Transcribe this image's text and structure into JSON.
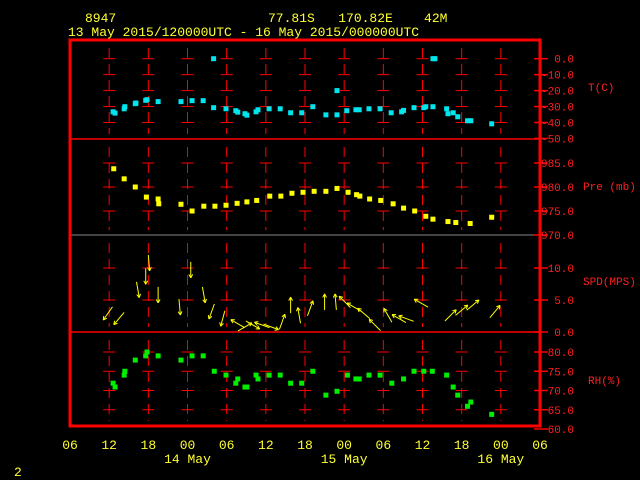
{
  "header": {
    "station_id": "8947",
    "location": "77.81S   170.82E    42M",
    "time_range": "13 May 2015/120000UTC - 16 May 2015/000000UTC"
  },
  "page_number": "2",
  "colors": {
    "frame": "#ff0000",
    "text": "#ffff33",
    "temp": "#00e5ee",
    "pressure": "#ffff00",
    "wind": "#ffff00",
    "rh": "#00ee00",
    "axis": "#ff2020"
  },
  "chart_data": [
    {
      "type": "scatter",
      "title": "T(C)",
      "ylabel": "T(C)",
      "x_units": "hours since 13 May 2015 06UTC",
      "xlim": [
        0,
        72
      ],
      "ylim": [
        -50,
        0
      ],
      "y_ticks": [
        "0.0",
        "-10.0",
        "-20.0",
        "-30.0",
        "-40.0",
        "-50.0"
      ],
      "x": [
        6.6,
        6.9,
        8.3,
        8.4,
        10,
        10.1,
        11.6,
        11.8,
        13.5,
        17,
        18.7,
        20.4,
        22,
        23.9,
        25.4,
        25.7,
        26.8,
        27.1,
        28.5,
        28.8,
        30.5,
        32.2,
        33.8,
        35.5,
        37.2,
        39.2,
        40.9,
        42.4,
        43.8,
        44.3,
        45.8,
        47.5,
        49.2,
        50.8,
        51.1,
        52.7,
        54.2,
        54.5,
        55.6,
        57.7,
        57.9,
        58.7,
        59.4,
        60.9,
        61.4,
        64.6,
        22,
        40.9,
        55.6,
        55.9
      ],
      "y": [
        -33.3,
        -34.1,
        -31.4,
        -30.1,
        -28.2,
        -27.8,
        -26.1,
        -25.7,
        -26.9,
        -26.9,
        -26.3,
        -26.3,
        -30.7,
        -31.4,
        -32.6,
        -33.5,
        -34.5,
        -35.4,
        -33.3,
        -32,
        -31.4,
        -31.4,
        -33.9,
        -33.9,
        -30.1,
        -35.2,
        -35.2,
        -32.6,
        -32,
        -32,
        -31.4,
        -31.4,
        -33.9,
        -33.3,
        -32.4,
        -30.7,
        -30.7,
        -30.1,
        -30.1,
        -31.4,
        -34.5,
        -33.9,
        -36.4,
        -38.9,
        -38.9,
        -40.8,
        0,
        -20,
        0,
        0
      ]
    },
    {
      "type": "scatter",
      "title": "Pre (mb)",
      "ylabel": "Pre (mb)",
      "xlim": [
        0,
        72
      ],
      "ylim": [
        970,
        988
      ],
      "y_ticks": [
        "985.0",
        "980.0",
        "975.0",
        "970.0"
      ],
      "x": [
        6.7,
        8.3,
        10,
        11.7,
        13.5,
        13.6,
        17,
        18.7,
        20.5,
        22.2,
        23.9,
        25.6,
        27.1,
        28.6,
        30.6,
        32.3,
        34,
        35.7,
        37.4,
        39.2,
        40.9,
        42.6,
        43.9,
        44.4,
        45.9,
        47.6,
        49.5,
        51.1,
        52.8,
        54.5,
        55.6,
        57.9,
        59.1,
        61.3,
        64.6
      ],
      "y": [
        983.8,
        981.7,
        980,
        977.9,
        977.5,
        976.5,
        976.4,
        975,
        976,
        976,
        976.2,
        976.6,
        976.9,
        977.2,
        978.1,
        978.1,
        978.7,
        978.9,
        979.1,
        979.1,
        979.7,
        978.9,
        978.4,
        978.1,
        977.5,
        977.2,
        976.5,
        975.6,
        975,
        973.9,
        973.3,
        972.8,
        972.6,
        972.4,
        973.7
      ]
    },
    {
      "type": "vector",
      "title": "SPD(MPS)",
      "ylabel": "SPD(MPS)",
      "xlim": [
        0,
        72
      ],
      "ylim": [
        0,
        12
      ],
      "y_ticks": [
        "10.0",
        "5.0",
        "0.0"
      ],
      "x": [
        5.8,
        7.5,
        10.4,
        11.6,
        12.1,
        13.5,
        16.8,
        18.5,
        20.5,
        21.7,
        23.4,
        25.7,
        26.8,
        28,
        29.4,
        30.8,
        32.5,
        33.8,
        35.1,
        36.8,
        39,
        40.7,
        42.1,
        43.5,
        45,
        46.7,
        48.7,
        50.4,
        51.5,
        53.8,
        58.3,
        60,
        61.7,
        65.1
      ],
      "speed": [
        2.9,
        2.1,
        6.6,
        8.7,
        10.8,
        5.8,
        3.9,
        9.7,
        5.8,
        3.2,
        2.1,
        1.3,
        0.8,
        1.1,
        1.1,
        0.8,
        1.6,
        4.2,
        2.6,
        3.7,
        4.7,
        4.7,
        4.7,
        3.9,
        2.9,
        1.1,
        2.6,
        2.1,
        2.1,
        4.5,
        2.6,
        3.4,
        4.2,
        3.2
      ],
      "direction_deg": [
        215,
        220,
        170,
        180,
        175,
        180,
        175,
        180,
        170,
        200,
        195,
        300,
        60,
        120,
        290,
        110,
        20,
        0,
        350,
        20,
        0,
        355,
        315,
        300,
        310,
        315,
        330,
        300,
        290,
        300,
        45,
        50,
        50,
        40
      ]
    },
    {
      "type": "scatter",
      "title": "RH(%)",
      "ylabel": "RH(%)",
      "xlim": [
        0,
        72
      ],
      "ylim": [
        60,
        83
      ],
      "y_ticks": [
        "80.0",
        "75.0",
        "70.0",
        "65.0",
        "60.0"
      ],
      "x": [
        6.6,
        6.9,
        8.3,
        8.4,
        10,
        11.6,
        11.8,
        13.5,
        17,
        18.7,
        20.4,
        22.1,
        23.9,
        25.4,
        25.7,
        26.8,
        27.1,
        28.5,
        28.8,
        30.5,
        32.2,
        33.8,
        35.5,
        37.2,
        39.2,
        40.9,
        42.5,
        43.8,
        44.3,
        45.8,
        47.5,
        49.3,
        51.1,
        52.7,
        54.2,
        55.5,
        57.7,
        58.7,
        59.4,
        60.9,
        61.4,
        64.6
      ],
      "y": [
        71.9,
        70.9,
        74,
        75,
        77.9,
        79,
        80,
        79,
        77.9,
        79,
        79,
        75,
        74,
        71.9,
        73,
        70.9,
        70.9,
        74,
        73,
        74,
        74,
        71.9,
        71.9,
        75,
        68.8,
        69.8,
        74,
        73,
        73,
        74,
        74,
        71.9,
        73,
        75,
        75,
        75,
        74,
        70.9,
        68.8,
        65.9,
        67,
        63.8
      ]
    }
  ],
  "x_axis": {
    "tick_labels": [
      "06",
      "12",
      "18",
      "00",
      "06",
      "12",
      "18",
      "00",
      "06",
      "12",
      "18",
      "00",
      "06"
    ],
    "date_labels": [
      "14 May",
      "15 May",
      "16 May"
    ]
  }
}
